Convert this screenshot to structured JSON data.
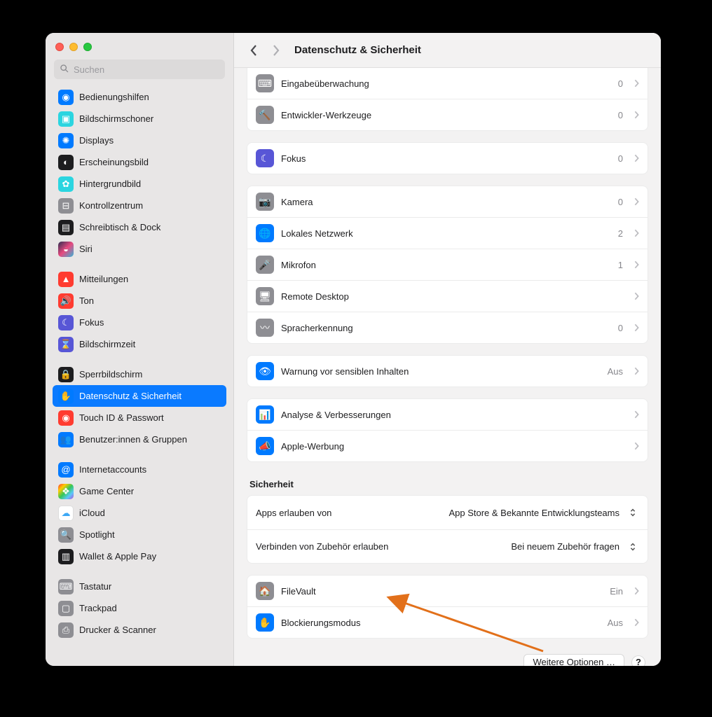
{
  "search": {
    "placeholder": "Suchen"
  },
  "header": {
    "title": "Datenschutz & Sicherheit"
  },
  "sidebar_groups": [
    [
      {
        "label": "Bedienungshilfen",
        "icon": "accessibility",
        "color": "#007aff"
      },
      {
        "label": "Bildschirmschoner",
        "icon": "screensaver",
        "color": "#2bd5e0"
      },
      {
        "label": "Displays",
        "icon": "displays",
        "color": "#007aff"
      },
      {
        "label": "Erscheinungsbild",
        "icon": "appearance",
        "color": "#1d1d1f"
      },
      {
        "label": "Hintergrundbild",
        "icon": "wallpaper",
        "color": "#2bd5e0"
      },
      {
        "label": "Kontrollzentrum",
        "icon": "control-center",
        "color": "#8e8e93"
      },
      {
        "label": "Schreibtisch & Dock",
        "icon": "dock",
        "color": "#1d1d1f"
      },
      {
        "label": "Siri",
        "icon": "siri",
        "color": "#1d1d1f"
      }
    ],
    [
      {
        "label": "Mitteilungen",
        "icon": "notifications",
        "color": "#ff3b30"
      },
      {
        "label": "Ton",
        "icon": "sound",
        "color": "#ff3b30"
      },
      {
        "label": "Fokus",
        "icon": "focus",
        "color": "#5856d6"
      },
      {
        "label": "Bildschirmzeit",
        "icon": "screentime",
        "color": "#5856d6"
      }
    ],
    [
      {
        "label": "Sperrbildschirm",
        "icon": "lockscreen",
        "color": "#1d1d1f"
      },
      {
        "label": "Datenschutz & Sicherheit",
        "icon": "privacy",
        "color": "#007aff",
        "selected": true
      },
      {
        "label": "Touch ID & Passwort",
        "icon": "touchid",
        "color": "#ff3b30"
      },
      {
        "label": "Benutzer:innen & Gruppen",
        "icon": "users",
        "color": "#007aff"
      }
    ],
    [
      {
        "label": "Internetaccounts",
        "icon": "internet",
        "color": "#007aff"
      },
      {
        "label": "Game Center",
        "icon": "gamecenter",
        "color": "#ffffff"
      },
      {
        "label": "iCloud",
        "icon": "icloud",
        "color": "#ffffff"
      },
      {
        "label": "Spotlight",
        "icon": "spotlight",
        "color": "#8e8e93"
      },
      {
        "label": "Wallet & Apple Pay",
        "icon": "wallet",
        "color": "#1d1d1f"
      }
    ],
    [
      {
        "label": "Tastatur",
        "icon": "keyboard",
        "color": "#8e8e93"
      },
      {
        "label": "Trackpad",
        "icon": "trackpad",
        "color": "#8e8e93"
      },
      {
        "label": "Drucker & Scanner",
        "icon": "printer",
        "color": "#8e8e93"
      }
    ]
  ],
  "privacy_groups": [
    [
      {
        "label": "Eingabeüberwachung",
        "value": "0",
        "icon": "keyboard-input",
        "color": "#8e8e93"
      },
      {
        "label": "Entwickler-Werkzeuge",
        "value": "0",
        "icon": "devtools",
        "color": "#8e8e93"
      }
    ],
    [
      {
        "label": "Fokus",
        "value": "0",
        "icon": "focus",
        "color": "#5856d6"
      }
    ],
    [
      {
        "label": "Kamera",
        "value": "0",
        "icon": "camera",
        "color": "#8e8e93"
      },
      {
        "label": "Lokales Netzwerk",
        "value": "2",
        "icon": "network",
        "color": "#007aff"
      },
      {
        "label": "Mikrofon",
        "value": "1",
        "icon": "microphone",
        "color": "#8e8e93"
      },
      {
        "label": "Remote Desktop",
        "value": "",
        "icon": "remote",
        "color": "#8e8e93"
      },
      {
        "label": "Spracherkennung",
        "value": "0",
        "icon": "speech",
        "color": "#8e8e93"
      }
    ],
    [
      {
        "label": "Warnung vor sensiblen Inhalten",
        "value": "Aus",
        "icon": "sensitive",
        "color": "#007aff"
      }
    ],
    [
      {
        "label": "Analyse & Verbesserungen",
        "value": "",
        "icon": "analytics",
        "color": "#007aff"
      },
      {
        "label": "Apple-Werbung",
        "value": "",
        "icon": "ads",
        "color": "#007aff"
      }
    ]
  ],
  "security_section_title": "Sicherheit",
  "security_selects": [
    {
      "label": "Apps erlauben von",
      "value": "App Store & Bekannte Entwicklungsteams"
    },
    {
      "label": "Verbinden von Zubehör erlauben",
      "value": "Bei neuem Zubehör fragen"
    }
  ],
  "security_rows": [
    {
      "label": "FileVault",
      "value": "Ein",
      "icon": "filevault",
      "color": "#8e8e93"
    },
    {
      "label": "Blockierungsmodus",
      "value": "Aus",
      "icon": "lockdown",
      "color": "#007aff"
    }
  ],
  "footer": {
    "more": "Weitere Optionen …",
    "help": "?"
  }
}
